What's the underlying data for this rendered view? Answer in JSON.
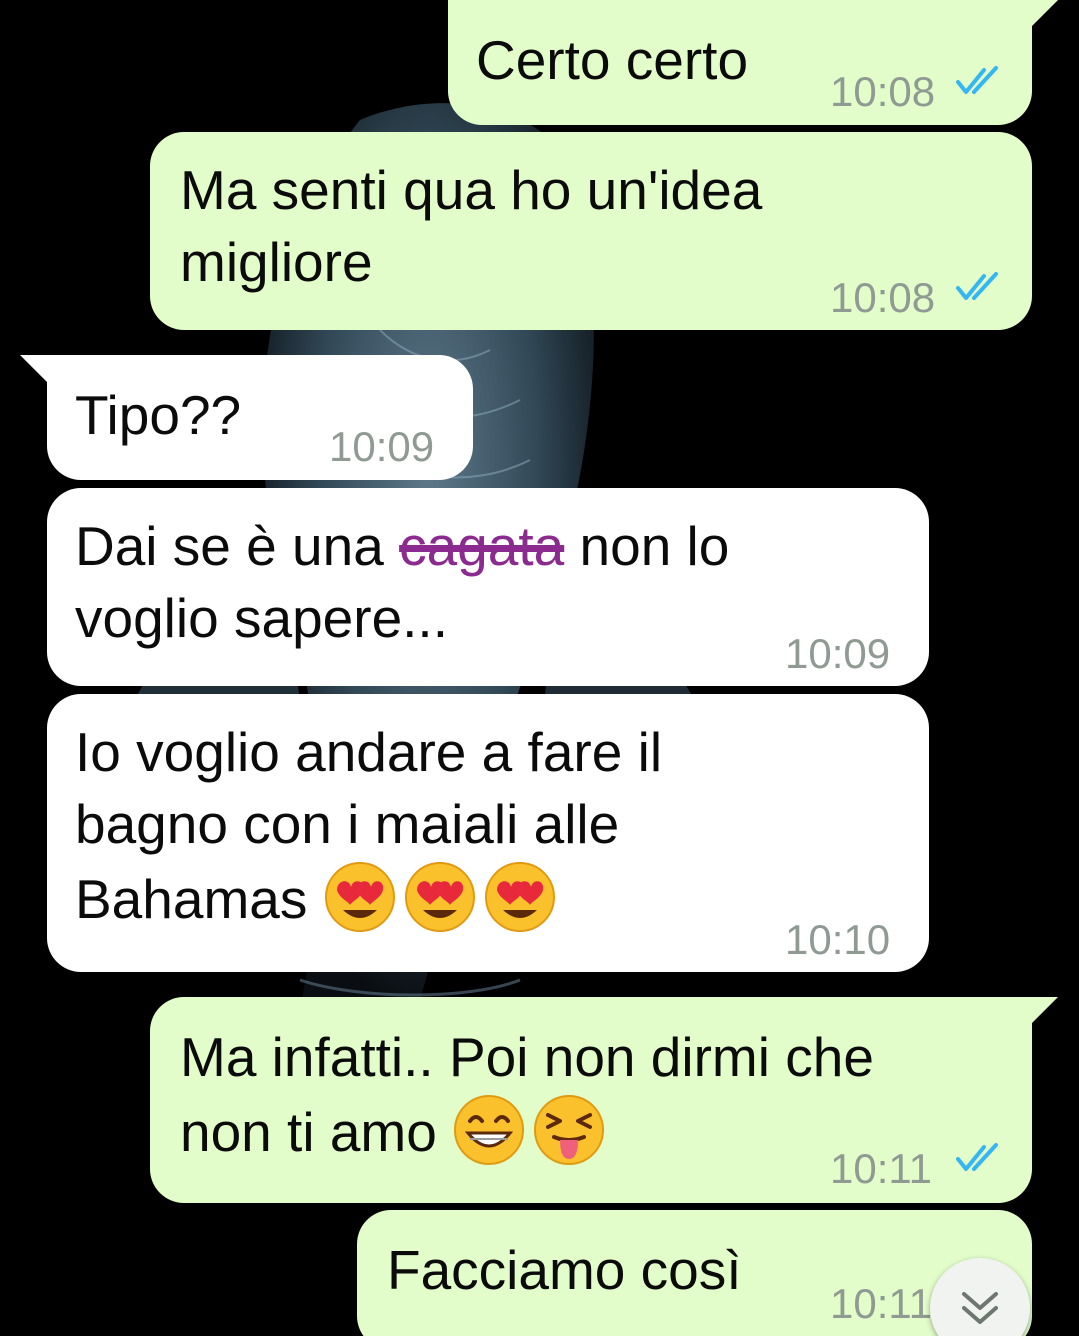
{
  "colors": {
    "outgoing_bubble": "#e2fdca",
    "incoming_bubble": "#ffffff",
    "read_ticks": "#34b7f1",
    "timestamp": "#8f9a92",
    "strikethrough": "#8b2a8f"
  },
  "messages": [
    {
      "direction": "outgoing",
      "text": "Certo certo",
      "time": "10:08",
      "status": "read",
      "status_icon": "double-check-icon"
    },
    {
      "direction": "outgoing",
      "text": "Ma senti qua ho un'idea\nmigliore",
      "time": "10:08",
      "status": "read",
      "status_icon": "double-check-icon"
    },
    {
      "direction": "incoming",
      "text": "Tipo??",
      "time": "10:09"
    },
    {
      "direction": "incoming",
      "text_before": "Dai se è una ",
      "text_struck": "cagata",
      "text_after": " non lo\nvoglio sapere...",
      "time": "10:09"
    },
    {
      "direction": "incoming",
      "text": "Io voglio andare a fare il\nbagno con i maiali alle\nBahamas",
      "emoji": [
        "heart-eyes-emoji",
        "heart-eyes-emoji",
        "heart-eyes-emoji"
      ],
      "time": "10:10"
    },
    {
      "direction": "outgoing",
      "text": "Ma infatti.. Poi non dirmi che\nnon ti amo",
      "emoji": [
        "grinning-emoji",
        "squinting-tongue-emoji"
      ],
      "time": "10:11",
      "status": "read",
      "status_icon": "double-check-icon"
    },
    {
      "direction": "outgoing",
      "text": "Facciamo così",
      "time": "10:11",
      "status": "read",
      "status_icon": "double-check-icon"
    }
  ],
  "scroll_button": {
    "icon": "double-chevron-down-icon"
  }
}
